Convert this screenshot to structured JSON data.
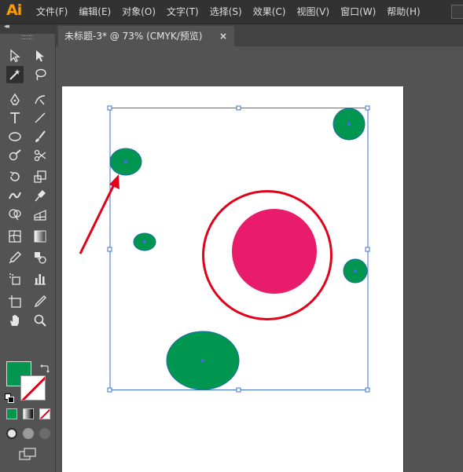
{
  "app": {
    "logo": "Ai"
  },
  "menu": {
    "items": [
      "文件(F)",
      "编辑(E)",
      "对象(O)",
      "文字(T)",
      "选择(S)",
      "效果(C)",
      "视图(V)",
      "窗口(W)",
      "帮助(H)"
    ]
  },
  "document": {
    "tab_title": "未标题-3* @ 73% (CMYK/预览)",
    "close_glyph": "×"
  },
  "toolbar": {
    "collapse_glyph": "◂◂",
    "tools": [
      "selection-tool",
      "direct-selection-tool",
      "magic-wand-tool",
      "lasso-tool",
      "pen-tool",
      "curvature-tool",
      "type-tool",
      "line-segment-tool",
      "ellipse-tool",
      "paintbrush-tool",
      "shaper-tool",
      "scissors-tool",
      "rotate-tool",
      "scale-tool",
      "width-tool",
      "puppet-warp-tool",
      "shape-builder-tool",
      "perspective-grid-tool",
      "mesh-tool",
      "gradient-tool",
      "eyedropper-tool",
      "blend-tool",
      "symbol-sprayer-tool",
      "column-graph-tool",
      "artboard-tool",
      "slice-tool",
      "hand-tool",
      "zoom-tool"
    ],
    "active_tool": "magic-wand-tool",
    "fill_color": "#00964f",
    "stroke_color": "none"
  },
  "colors": {
    "green_fill": "#00964f",
    "green_stroke": "#1a6aa8",
    "magenta_fill": "#e81c6a",
    "ring_stroke": "#e2001a",
    "arrow": "#e2001a",
    "selection": "#3f6fd6"
  }
}
